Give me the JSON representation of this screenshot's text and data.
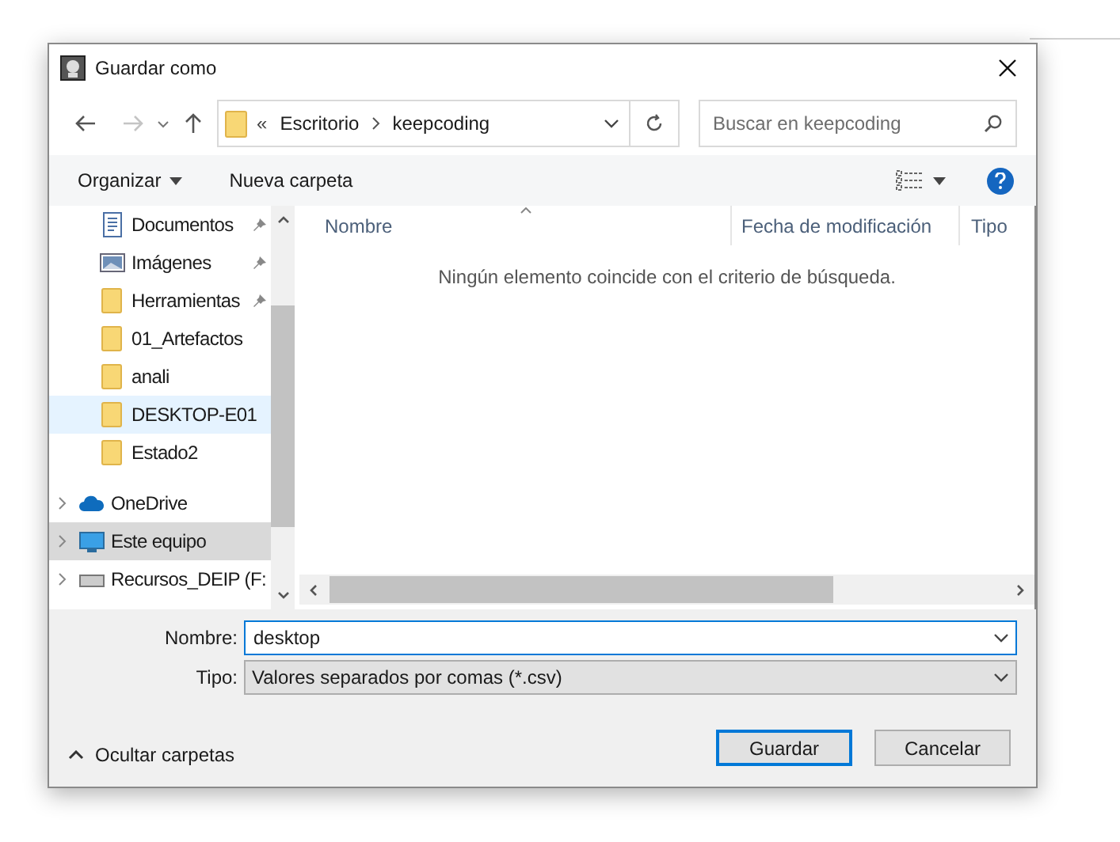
{
  "window": {
    "title": "Guardar como"
  },
  "address": {
    "overflow": "«",
    "crumbs": [
      "Escritorio",
      "keepcoding"
    ]
  },
  "search": {
    "placeholder": "Buscar en keepcoding"
  },
  "toolbar": {
    "organize": "Organizar",
    "new_folder": "Nueva carpeta"
  },
  "nav": [
    {
      "label": "Documentos",
      "kind": "document",
      "pinned": true,
      "selected": false,
      "hovered": false,
      "expandable": false
    },
    {
      "label": "Imágenes",
      "kind": "pictures",
      "pinned": true,
      "selected": false,
      "hovered": false,
      "expandable": false
    },
    {
      "label": "Herramientas",
      "kind": "folder",
      "pinned": true,
      "selected": false,
      "hovered": false,
      "expandable": false
    },
    {
      "label": "01_Artefactos",
      "kind": "folder",
      "pinned": false,
      "selected": false,
      "hovered": false,
      "expandable": false
    },
    {
      "label": "anali",
      "kind": "folder",
      "pinned": false,
      "selected": false,
      "hovered": false,
      "expandable": false
    },
    {
      "label": "DESKTOP-E01",
      "kind": "folder",
      "pinned": false,
      "selected": false,
      "hovered": true,
      "expandable": false
    },
    {
      "label": "Estado2",
      "kind": "folder",
      "pinned": false,
      "selected": false,
      "hovered": false,
      "expandable": false
    },
    {
      "label": "OneDrive",
      "kind": "cloud",
      "pinned": false,
      "selected": false,
      "hovered": false,
      "expandable": true
    },
    {
      "label": "Este equipo",
      "kind": "computer",
      "pinned": false,
      "selected": true,
      "hovered": false,
      "expandable": true
    },
    {
      "label": "Recursos_DEIP (F:",
      "kind": "drive",
      "pinned": false,
      "selected": false,
      "hovered": false,
      "expandable": true
    }
  ],
  "table": {
    "columns": [
      "Nombre",
      "Fecha de modificación",
      "Tipo"
    ],
    "empty_message": "Ningún elemento coincide con el criterio de búsqueda."
  },
  "form": {
    "name_label": "Nombre:",
    "name_value": "desktop",
    "type_label": "Tipo:",
    "type_value": "Valores separados por comas (*.csv)"
  },
  "hide_folders": "Ocultar carpetas",
  "buttons": [
    {
      "label": "Guardar",
      "default": true
    },
    {
      "label": "Cancelar",
      "default": false
    }
  ]
}
